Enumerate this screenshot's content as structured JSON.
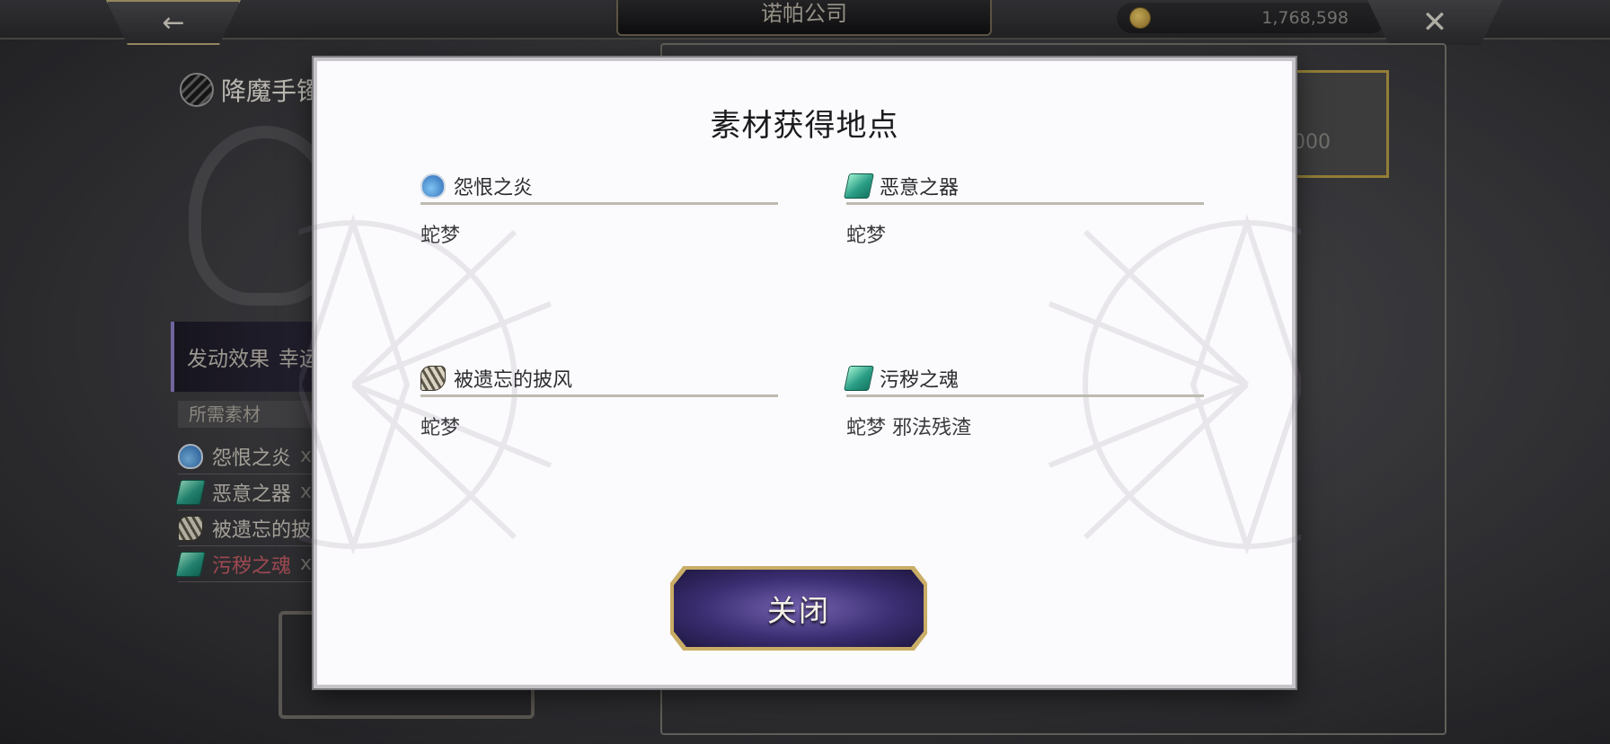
{
  "header": {
    "back_icon": "arrow-left-icon",
    "title": "诺帕公司",
    "currency_icon": "coin-icon",
    "currency_amount": "1,768,598",
    "close_icon": "close-x-icon"
  },
  "background": {
    "item_title": "降魔手镯",
    "price_partial": "0,000",
    "effect_label": "发动效果",
    "effect_value": "幸运",
    "required_header": "所需素材",
    "required": [
      {
        "name": "怨恨之炎",
        "qty": "x",
        "icon": "potion-icon",
        "highlight": false
      },
      {
        "name": "恶意之器",
        "qty": "x",
        "icon": "crystal-icon",
        "highlight": false
      },
      {
        "name": "被遗忘的披",
        "qty": "",
        "icon": "cloak-icon",
        "highlight": false
      },
      {
        "name": "污秽之魂",
        "qty": "x",
        "icon": "crystal-icon",
        "highlight": true
      }
    ]
  },
  "dialog": {
    "title": "素材获得地点",
    "materials": [
      {
        "name": "怨恨之炎",
        "icon": "potion-icon",
        "locations": "蛇梦"
      },
      {
        "name": "恶意之器",
        "icon": "crystal-icon",
        "locations": "蛇梦"
      },
      {
        "name": "被遗忘的披风",
        "icon": "cloak-icon",
        "locations": "蛇梦"
      },
      {
        "name": "污秽之魂",
        "icon": "crystal-icon",
        "locations": "蛇梦 邪法残渣"
      }
    ],
    "close_label": "关闭"
  }
}
